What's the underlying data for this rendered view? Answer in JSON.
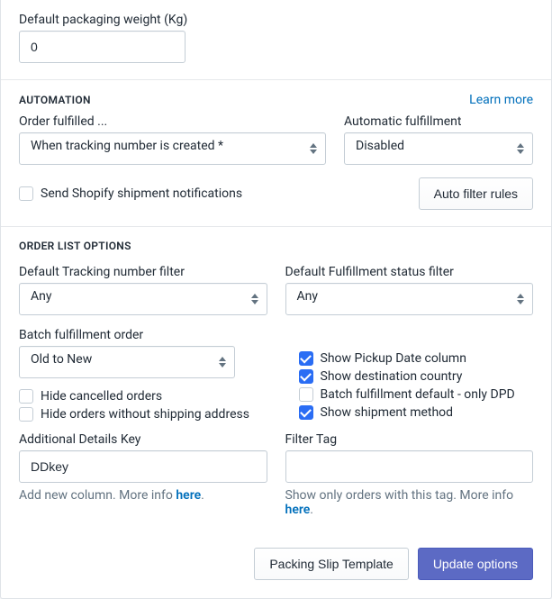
{
  "packaging": {
    "label": "Default packaging weight (Kg)",
    "value": "0"
  },
  "automation": {
    "title": "AUTOMATION",
    "learn_more": "Learn more",
    "order_fulfilled_label": "Order fulfilled ...",
    "order_fulfilled_value": "When tracking number is created *",
    "automatic_label": "Automatic fulfillment",
    "automatic_value": "Disabled",
    "send_notifications_label": "Send Shopify shipment notifications",
    "auto_filter_btn": "Auto filter rules"
  },
  "orderlist": {
    "title": "ORDER LIST OPTIONS",
    "tracking_filter_label": "Default Tracking number filter",
    "tracking_filter_value": "Any",
    "fulfillment_filter_label": "Default Fulfillment status filter",
    "fulfillment_filter_value": "Any",
    "batch_order_label": "Batch fulfillment order",
    "batch_order_value": "Old to New",
    "hide_cancelled_label": "Hide cancelled orders",
    "hide_noaddr_label": "Hide orders without shipping address",
    "opts": {
      "show_pickup": "Show Pickup Date column",
      "show_country": "Show destination country",
      "batch_dpd": "Batch fulfillment default - only DPD",
      "show_method": "Show shipment method"
    },
    "details_key_label": "Additional Details Key",
    "details_key_value": "DDkey",
    "details_helper_prefix": "Add new column. More info ",
    "details_helper_link": "here",
    "filter_tag_label": "Filter Tag",
    "filter_tag_helper_prefix": "Show only orders with this tag. More info ",
    "filter_tag_helper_link": "here"
  },
  "buttons": {
    "packing_slip": "Packing Slip Template",
    "update": "Update options"
  }
}
